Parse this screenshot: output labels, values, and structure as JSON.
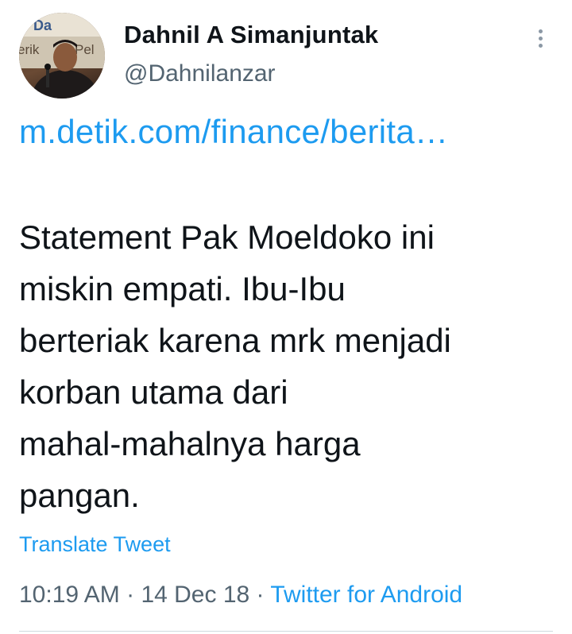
{
  "user": {
    "display_name": "Dahnil A Simanjuntak",
    "handle": "@Dahnilanzar",
    "avatar_backdrop_text": [
      "Da",
      "erik",
      "Pel"
    ]
  },
  "tweet": {
    "link_text": "m.detik.com/finance/berita…",
    "body_lines": [
      "Statement Pak Moeldoko ini",
      "miskin empati. Ibu-Ibu",
      "berteriak karena mrk menjadi",
      "korban utama dari",
      "mahal-mahalnya harga",
      "pangan."
    ],
    "translate_label": "Translate Tweet",
    "time": "10:19 AM",
    "separator": " · ",
    "date": "14 Dec 18",
    "source": "Twitter for Android"
  },
  "icons": {
    "more": "more-vertical-icon"
  },
  "colors": {
    "link": "#1d9bf0",
    "text": "#0f1419",
    "secondary": "#536471",
    "divider": "#cfd9de"
  }
}
